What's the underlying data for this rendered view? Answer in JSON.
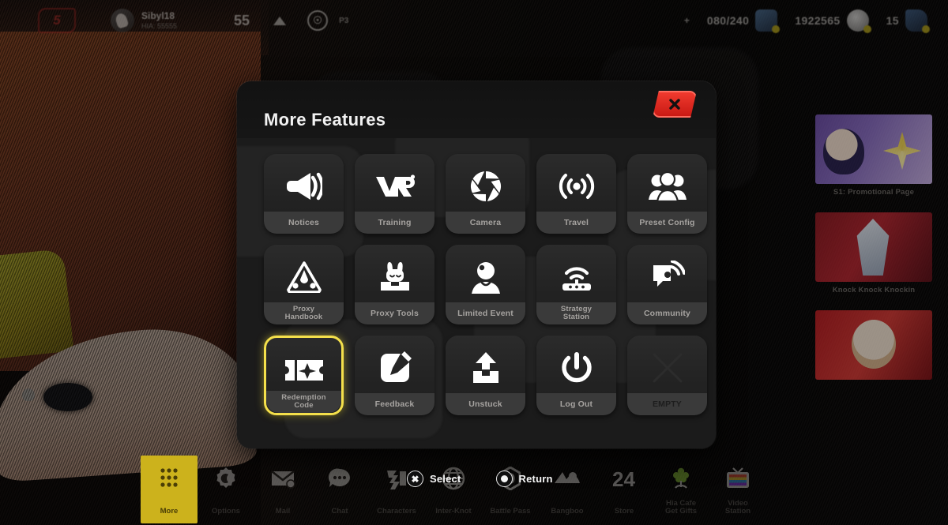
{
  "hud": {
    "logo_icon": "game-logo-icon",
    "player_name": "Sibyl18",
    "player_subtitle": "HIA: 55555",
    "level": "55",
    "rank_icon": "rank-triangle-icon",
    "coin_icon": "coin-icon",
    "battery_label": "P3",
    "plus_label": "+",
    "stats": [
      {
        "value": "080/240",
        "icon": "stamina-battery-icon"
      },
      {
        "value": "1922565",
        "icon": "dennies-currency-icon"
      },
      {
        "value": "15",
        "icon": "polychrome-icon"
      }
    ]
  },
  "event_rail": {
    "cards": [
      {
        "label": "S1: Promotional Page",
        "icon": "event-thumb-1"
      },
      {
        "label": "Knock Knock Knockin",
        "icon": "event-thumb-2"
      },
      {
        "label": "",
        "icon": "event-thumb-3"
      }
    ]
  },
  "modal": {
    "title": "More Features",
    "close_label": "close-button",
    "tiles": [
      {
        "label": "Notices",
        "icon": "megaphone-icon",
        "lines": 1,
        "selected": false,
        "empty": false
      },
      {
        "label": "Training",
        "icon": "vr-icon",
        "lines": 1,
        "selected": false,
        "empty": false
      },
      {
        "label": "Camera",
        "icon": "aperture-icon",
        "lines": 1,
        "selected": false,
        "empty": false
      },
      {
        "label": "Travel",
        "icon": "broadcast-icon",
        "lines": 1,
        "selected": false,
        "empty": false
      },
      {
        "label": "Preset Config",
        "icon": "group-icon",
        "lines": 1,
        "selected": false,
        "empty": false
      },
      {
        "label": "Proxy\nHandbook",
        "icon": "triangle-pen-icon",
        "lines": 2,
        "selected": false,
        "empty": false
      },
      {
        "label": "Proxy Tools",
        "icon": "bunny-bot-icon",
        "lines": 1,
        "selected": false,
        "empty": false
      },
      {
        "label": "Limited Event",
        "icon": "person-icon",
        "lines": 1,
        "selected": false,
        "empty": false
      },
      {
        "label": "Strategy\nStation",
        "icon": "router-wifi-icon",
        "lines": 2,
        "selected": false,
        "empty": false
      },
      {
        "label": "Community",
        "icon": "chat-signal-icon",
        "lines": 1,
        "selected": false,
        "empty": false
      },
      {
        "label": "Redemption\nCode",
        "icon": "ticket-icon",
        "lines": 2,
        "selected": true,
        "empty": false
      },
      {
        "label": "Feedback",
        "icon": "edit-pencil-icon",
        "lines": 1,
        "selected": false,
        "empty": false
      },
      {
        "label": "Unstuck",
        "icon": "unstuck-icon",
        "lines": 1,
        "selected": false,
        "empty": false
      },
      {
        "label": "Log Out",
        "icon": "power-icon",
        "lines": 1,
        "selected": false,
        "empty": false
      },
      {
        "label": "EMPTY",
        "icon": "x-cross-icon",
        "lines": 1,
        "selected": false,
        "empty": true
      }
    ]
  },
  "prompts": [
    {
      "button": "cross-button-icon",
      "label": "Select"
    },
    {
      "button": "circle-button-icon",
      "label": "Return"
    }
  ],
  "bottom_nav": {
    "items": [
      {
        "label": "More",
        "icon": "grid-menu-icon",
        "active": true
      },
      {
        "label": "Options",
        "icon": "gear-moon-icon",
        "active": false
      },
      {
        "label": "Mail",
        "icon": "mail-icon",
        "active": false
      },
      {
        "label": "Chat",
        "icon": "chat-dots-icon",
        "active": false
      },
      {
        "label": "Characters",
        "icon": "character-icon",
        "active": false
      },
      {
        "label": "Inter-Knot",
        "icon": "globe-icon",
        "active": false
      },
      {
        "label": "Battle Pass",
        "icon": "hex-badge-icon",
        "active": false
      },
      {
        "label": "Bangboo",
        "icon": "bangboo-icon",
        "active": false
      },
      {
        "label": "Store",
        "icon": "24-shop-icon",
        "active": false
      },
      {
        "label": "Hia Cafe\nGet Gifts",
        "icon": "plant-icon",
        "active": false
      },
      {
        "label": "Video\nStation",
        "icon": "tv-icon",
        "active": false
      }
    ]
  },
  "colors": {
    "accent_yellow": "#f4e04b",
    "nav_active": "#ccb21c",
    "close_red": "#e8342a",
    "modal_bg": "#1b1b1b",
    "tile_bg": "#262626",
    "label_bg": "#3a3a3a"
  }
}
